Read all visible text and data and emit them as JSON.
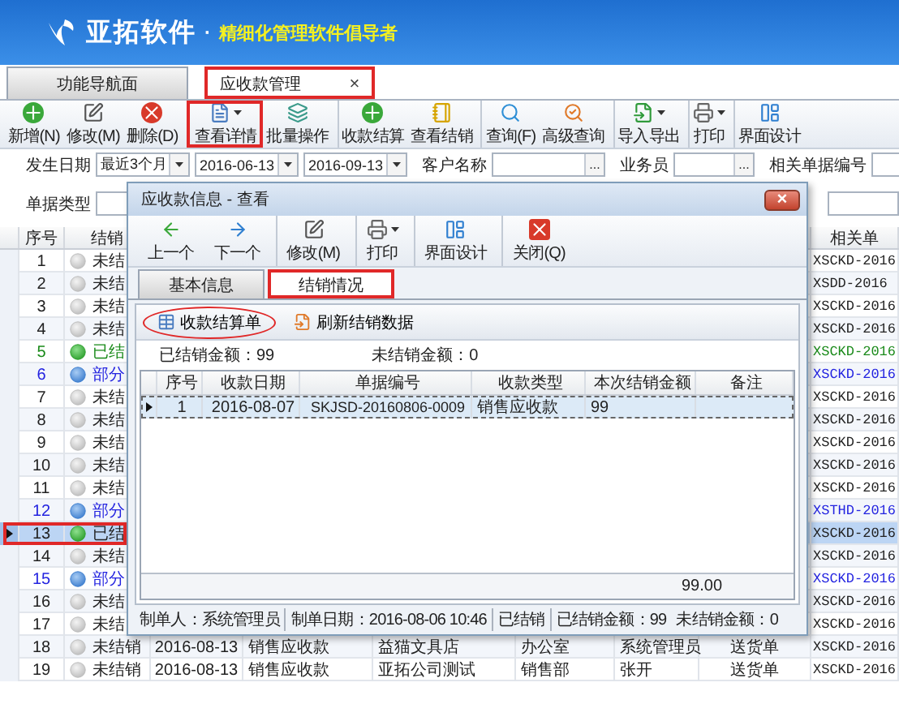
{
  "app": {
    "name": "亚拓软件",
    "dot": "·",
    "slogan": "精细化管理软件倡导者"
  },
  "tabs": [
    {
      "label": "功能导航面",
      "selected": false,
      "highlighted": false
    },
    {
      "label": "应收款管理",
      "selected": true,
      "highlighted": true,
      "close": "×"
    }
  ],
  "toolbar": [
    {
      "label": "新增(N)",
      "dropdown": false,
      "highlighted": false,
      "separator_before": false
    },
    {
      "label": "修改(M)",
      "dropdown": false,
      "highlighted": false,
      "separator_before": false
    },
    {
      "label": "删除(D)",
      "dropdown": false,
      "highlighted": false,
      "separator_before": false
    },
    {
      "label": "查看详情",
      "dropdown": true,
      "highlighted": true,
      "separator_before": true
    },
    {
      "label": "批量操作",
      "dropdown": false,
      "highlighted": false,
      "separator_before": false
    },
    {
      "label": "收款结算",
      "dropdown": false,
      "highlighted": false,
      "separator_before": true
    },
    {
      "label": "查看结销",
      "dropdown": false,
      "highlighted": false,
      "separator_before": false
    },
    {
      "label": "查询(F)",
      "dropdown": false,
      "highlighted": false,
      "separator_before": true
    },
    {
      "label": "高级查询",
      "dropdown": false,
      "highlighted": false,
      "separator_before": false
    },
    {
      "label": "导入导出",
      "dropdown": true,
      "highlighted": false,
      "separator_before": true
    },
    {
      "label": "打印",
      "dropdown": true,
      "highlighted": false,
      "separator_before": true
    },
    {
      "label": "界面设计",
      "dropdown": false,
      "highlighted": false,
      "separator_before": true
    }
  ],
  "filters": [
    [
      {
        "kind": "label",
        "text": "发生日期"
      },
      {
        "kind": "combo",
        "value": "最近3个月"
      },
      {
        "kind": "combo",
        "value": "2016-06-13"
      },
      {
        "kind": "combo",
        "value": "2016-09-13"
      },
      {
        "kind": "label",
        "text": "客户名称"
      },
      {
        "kind": "lookup",
        "button": "..."
      },
      {
        "kind": "label",
        "text": "业务员"
      },
      {
        "kind": "lookup",
        "button": "..."
      },
      {
        "kind": "label",
        "text": "相关单据编号"
      },
      {
        "kind": "text"
      }
    ],
    [
      {
        "kind": "label",
        "text": "单据类型"
      },
      {
        "kind": "text"
      },
      {
        "kind": "text"
      }
    ]
  ],
  "table": {
    "columns": [
      "序号",
      "结销"
    ],
    "related_column": "相关单",
    "rows": [
      {
        "no": "1",
        "kind": "unsettled",
        "status_text": "未结",
        "related": "XSCKD-2016",
        "selected": false,
        "highlighted": false
      },
      {
        "no": "2",
        "kind": "unsettled",
        "status_text": "未结",
        "related": "XSDD-2016",
        "selected": false,
        "highlighted": false
      },
      {
        "no": "3",
        "kind": "unsettled",
        "status_text": "未结",
        "related": "XSCKD-2016",
        "selected": false,
        "highlighted": false
      },
      {
        "no": "4",
        "kind": "unsettled",
        "status_text": "未结",
        "related": "XSCKD-2016",
        "selected": false,
        "highlighted": false
      },
      {
        "no": "5",
        "kind": "settled",
        "status_text": "已结",
        "related": "XSCKD-2016",
        "selected": false,
        "highlighted": false
      },
      {
        "no": "6",
        "kind": "partial",
        "status_text": "部分",
        "related": "XSCKD-2016",
        "selected": false,
        "highlighted": false
      },
      {
        "no": "7",
        "kind": "unsettled",
        "status_text": "未结",
        "related": "XSCKD-2016",
        "selected": false,
        "highlighted": false
      },
      {
        "no": "8",
        "kind": "unsettled",
        "status_text": "未结",
        "related": "XSCKD-2016",
        "selected": false,
        "highlighted": false
      },
      {
        "no": "9",
        "kind": "unsettled",
        "status_text": "未结",
        "related": "XSCKD-2016",
        "selected": false,
        "highlighted": false
      },
      {
        "no": "10",
        "kind": "unsettled",
        "status_text": "未结",
        "related": "XSCKD-2016",
        "selected": false,
        "highlighted": false
      },
      {
        "no": "11",
        "kind": "unsettled",
        "status_text": "未结",
        "related": "XSCKD-2016",
        "selected": false,
        "highlighted": false
      },
      {
        "no": "12",
        "kind": "partial",
        "status_text": "部分",
        "related": "XSTHD-2016",
        "selected": false,
        "highlighted": false
      },
      {
        "no": "13",
        "kind": "settled",
        "status_text": "已结",
        "related": "XSCKD-2016",
        "selected": true,
        "highlighted": true
      },
      {
        "no": "14",
        "kind": "unsettled",
        "status_text": "未结",
        "related": "XSCKD-2016",
        "selected": false,
        "highlighted": false
      },
      {
        "no": "15",
        "kind": "partial",
        "status_text": "部分",
        "related": "XSCKD-2016",
        "selected": false,
        "highlighted": false
      },
      {
        "no": "16",
        "kind": "unsettled",
        "status_text": "未结",
        "related": "XSCKD-2016",
        "selected": false,
        "highlighted": false
      },
      {
        "no": "17",
        "kind": "unsettled",
        "status_text": "未结",
        "related": "XSCKD-2016",
        "selected": false,
        "highlighted": false
      },
      {
        "no": "18",
        "kind": "unsettled",
        "status_text": "未结销",
        "cells": [
          "2016-08-13",
          "销售应收款",
          "益猫文具店",
          "办公室",
          "系统管理员",
          "送货单"
        ],
        "related": "XSCKD-2016",
        "selected": false,
        "highlighted": false
      },
      {
        "no": "19",
        "kind": "unsettled",
        "status_text": "未结销",
        "cells": [
          "2016-08-13",
          "销售应收款",
          "亚拓公司测试",
          "销售部",
          "张开",
          "送货单"
        ],
        "related": "XSCKD-2016",
        "selected": false,
        "highlighted": false
      }
    ]
  },
  "dialog": {
    "title": "应收款信息 - 查看",
    "close": "×",
    "toolbar": [
      {
        "label": "上一个",
        "dropdown": false,
        "separator_before": false
      },
      {
        "label": "下一个",
        "dropdown": false,
        "separator_before": false
      },
      {
        "label": "修改(M)",
        "dropdown": false,
        "separator_before": true
      },
      {
        "label": "打印",
        "dropdown": true,
        "separator_before": true
      },
      {
        "label": "界面设计",
        "dropdown": false,
        "separator_before": true
      },
      {
        "label": "关闭(Q)",
        "dropdown": false,
        "separator_before": true
      }
    ],
    "tabs": [
      {
        "label": "基本信息",
        "selected": false,
        "highlighted": false
      },
      {
        "label": "结销情况",
        "selected": true,
        "highlighted": true
      }
    ],
    "actions": [
      {
        "label": "收款结算单",
        "highlighted": true
      },
      {
        "label": "刷新结销数据",
        "highlighted": false
      }
    ],
    "sums": [
      "已结销金额：99",
      "未结销金额：0"
    ],
    "grid": {
      "columns": [
        "序号",
        "收款日期",
        "单据编号",
        "收款类型",
        "本次结销金额",
        "备注"
      ],
      "rows": [
        {
          "cells": [
            "1",
            "2016-08-07",
            "SKJSD-20160806-0009",
            "销售应收款",
            "99"
          ],
          "selected": true
        }
      ],
      "total": "99.00"
    },
    "status": [
      "制单人：系统管理员",
      "制单日期：2016-08-06 10:46",
      "已结销",
      "已结销金额：99",
      "未结销金额：0"
    ]
  }
}
